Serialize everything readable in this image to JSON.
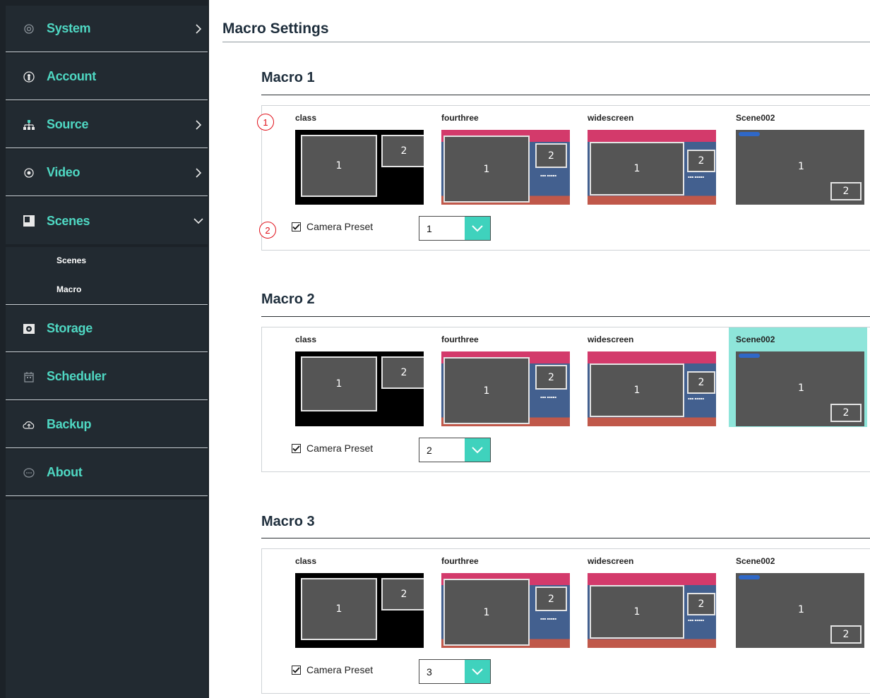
{
  "sidebar": {
    "items": [
      {
        "label": "System",
        "icon": "gear-icon"
      },
      {
        "label": "Account",
        "icon": "account-icon"
      },
      {
        "label": "Source",
        "icon": "network-tree-icon"
      },
      {
        "label": "Video",
        "icon": "radio-dot-icon"
      },
      {
        "label": "Scenes",
        "icon": "scenes-icon"
      },
      {
        "label": "Storage",
        "icon": "storage-icon"
      },
      {
        "label": "Scheduler",
        "icon": "calendar-icon"
      },
      {
        "label": "Backup",
        "icon": "cloud-upload-icon"
      },
      {
        "label": "About",
        "icon": "chat-bubble-icon"
      }
    ],
    "sub_items": [
      "Scenes",
      "Macro"
    ]
  },
  "page": {
    "title": "Macro Settings"
  },
  "macros": [
    {
      "title": "Macro 1",
      "scenes": [
        "class",
        "fourthree",
        "widescreen",
        "Scene002"
      ],
      "selected_scene": "",
      "camera_preset_label": "Camera Preset",
      "camera_preset_checked": true,
      "camera_preset_value": "1"
    },
    {
      "title": "Macro 2",
      "scenes": [
        "class",
        "fourthree",
        "widescreen",
        "Scene002"
      ],
      "selected_scene": "Scene002",
      "camera_preset_label": "Camera Preset",
      "camera_preset_checked": true,
      "camera_preset_value": "2"
    },
    {
      "title": "Macro 3",
      "scenes": [
        "class",
        "fourthree",
        "widescreen",
        "Scene002"
      ],
      "selected_scene": "",
      "camera_preset_label": "Camera Preset",
      "camera_preset_checked": true,
      "camera_preset_value": "3"
    }
  ],
  "thumb_labels": {
    "one": "1",
    "two": "2"
  },
  "callouts": [
    "1",
    "2"
  ],
  "colors": {
    "accent": "#4fd8c3",
    "selected_bg": "#8ee5da",
    "sidebar_bg": "#222a31",
    "callout": "#e0101a"
  }
}
